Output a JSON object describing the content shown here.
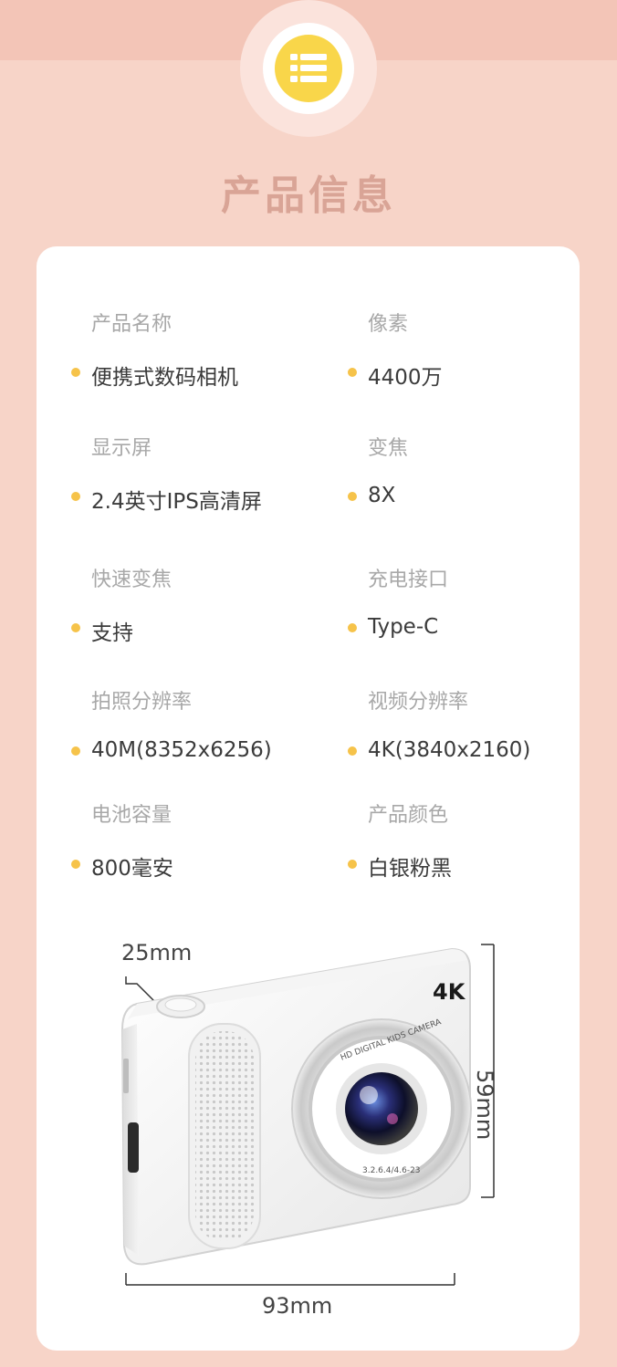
{
  "header": {
    "title": "产品信息",
    "icon": "list-icon",
    "colors": {
      "accent": "#f9d64a",
      "bullet": "#f6c34a",
      "background": "#f7d4c8"
    }
  },
  "specs": [
    {
      "label": "产品名称",
      "value": "便携式数码相机"
    },
    {
      "label": "像素",
      "value": "4400万"
    },
    {
      "label": "显示屏",
      "value": "2.4英寸IPS高清屏"
    },
    {
      "label": "变焦",
      "value": "8X"
    },
    {
      "label": "快速变焦",
      "value": "支持"
    },
    {
      "label": "充电接口",
      "value": "Type-C"
    },
    {
      "label": "拍照分辨率",
      "value": "40M(8352x6256)"
    },
    {
      "label": "视频分辨率",
      "value": "4K(3840x2160)"
    },
    {
      "label": "电池容量",
      "value": "800毫安"
    },
    {
      "label": "产品颜色",
      "value": "白银粉黑"
    }
  ],
  "product_image": {
    "depth": "25mm",
    "height": "59mm",
    "width": "93mm",
    "camera_badge": "4K",
    "lens_ring_text": "HD DIGITAL KIDS CAMERA",
    "lens_spec_text": "3.2.6.4/4.6-23"
  }
}
